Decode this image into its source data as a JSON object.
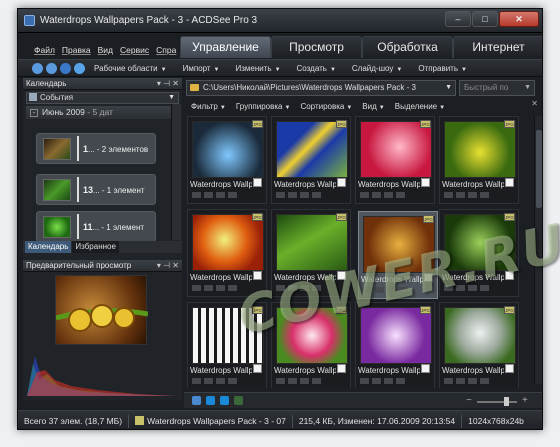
{
  "window": {
    "title": "Waterdrops Wallpapers Pack - 3 - ACDSee Pro 3"
  },
  "menu": [
    "Файл",
    "Правка",
    "Вид",
    "Сервис",
    "Спра"
  ],
  "modes": [
    "Управление",
    "Просмотр",
    "Обработка",
    "Интернет"
  ],
  "toolbar": {
    "items": [
      "Рабочие области",
      "Импорт",
      "Изменить",
      "Создать",
      "Слайд-шоу",
      "Отправить"
    ]
  },
  "calendar": {
    "header": "Календарь",
    "events_select": "События",
    "month": "Июнь 2009",
    "month_count": "- 5 дат",
    "days": [
      {
        "day": "1",
        "rest": "...",
        "count": "- 2 элементов"
      },
      {
        "day": "13",
        "rest": "...",
        "count": "- 1 элемент"
      },
      {
        "day": "11",
        "rest": "...",
        "count": "- 1 элемент"
      }
    ]
  },
  "left_tabs": [
    "Календарь",
    "Избранное"
  ],
  "preview": {
    "header": "Предварительный просмотр"
  },
  "browser": {
    "path": "C:\\Users\\Николай\\Pictures\\Waterdrops Wallpapers Pack - 3",
    "quick_search": "Быстрый по",
    "filters": [
      "Фильтр",
      "Группировка",
      "Сортировка",
      "Вид",
      "Выделение"
    ],
    "tile_label": "Waterdrops Wallp...",
    "badge": "JPG"
  },
  "status": {
    "total": "Всего 37 элем. (18,7 МБ)",
    "current": "Waterdrops Wallpapers Pack - 3 - 07",
    "info": "215,4 КБ, Изменен: 17.06.2009 20:13:54",
    "dimensions": "1024x768x24b"
  },
  "watermark": "COWER.RU",
  "colors": {
    "accent": "#3d5b78",
    "background": "#1b1e22",
    "active_tab": "#616b76"
  }
}
